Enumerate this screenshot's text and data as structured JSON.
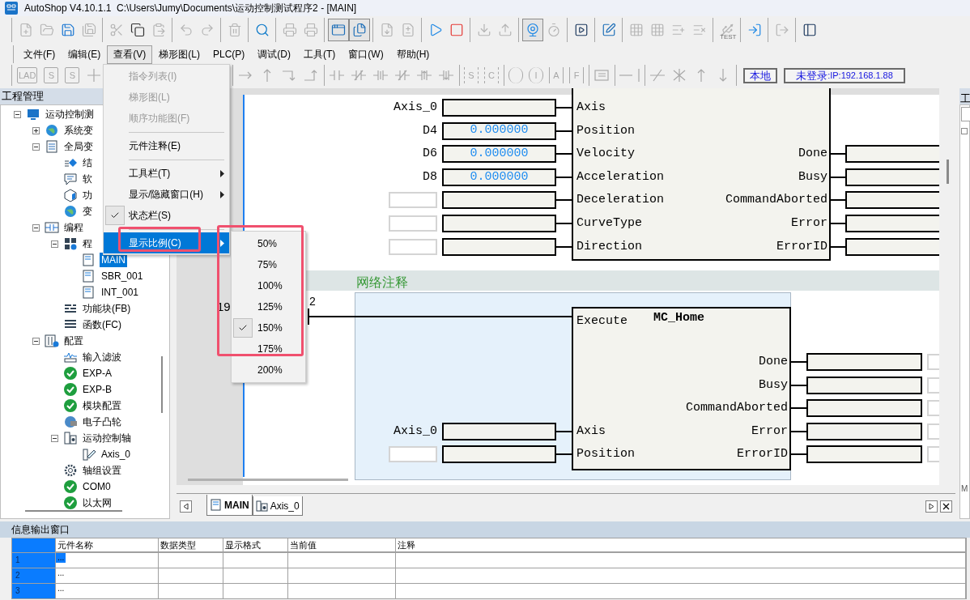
{
  "window": {
    "title": "AutoShop V4.10.1.1  C:\\Users\\Jumy\\Documents\\运动控制测试程序2 - [MAIN]"
  },
  "toolbar": {
    "groups": [
      [
        {
          "disabled": true,
          "pressed": false
        },
        {
          "disabled": true,
          "pressed": false
        },
        {
          "disabled": false,
          "pressed": false
        },
        {
          "disabled": true,
          "pressed": false
        }
      ],
      [
        {
          "disabled": true,
          "pressed": false
        },
        {
          "disabled": false,
          "pressed": false
        },
        {
          "disabled": true,
          "pressed": false
        }
      ],
      [
        {
          "disabled": true,
          "pressed": false
        },
        {
          "disabled": true,
          "pressed": false
        }
      ],
      [
        {
          "disabled": true,
          "pressed": false
        }
      ],
      [
        {
          "disabled": false,
          "pressed": false
        }
      ],
      [
        {
          "disabled": true,
          "pressed": false
        },
        {
          "disabled": true,
          "pressed": false
        }
      ],
      [
        {
          "disabled": false,
          "pressed": true
        },
        {
          "disabled": false,
          "pressed": true
        }
      ],
      [
        {
          "disabled": true,
          "pressed": false
        },
        {
          "disabled": true,
          "pressed": false
        }
      ],
      [
        {
          "disabled": false,
          "pressed": false
        },
        {
          "disabled": false,
          "pressed": false
        }
      ],
      [
        {
          "disabled": true,
          "pressed": false
        },
        {
          "disabled": true,
          "pressed": false
        }
      ],
      [
        {
          "disabled": false,
          "pressed": true
        },
        {
          "disabled": true,
          "pressed": false
        }
      ],
      [
        {
          "disabled": false,
          "pressed": false
        }
      ],
      [
        {
          "disabled": false,
          "pressed": false
        }
      ],
      [
        {
          "disabled": true,
          "pressed": false
        },
        {
          "disabled": true,
          "pressed": false
        },
        {
          "disabled": true,
          "pressed": false
        },
        {
          "disabled": true,
          "pressed": false
        }
      ],
      [
        {
          "disabled": true,
          "pressed": false,
          "glyph": "TEST"
        }
      ],
      [
        {
          "disabled": false,
          "pressed": false
        }
      ],
      [
        {
          "disabled": true,
          "pressed": false
        }
      ],
      [
        {
          "disabled": false,
          "pressed": false
        }
      ]
    ]
  },
  "menubar": [
    {
      "label": "文件(F)",
      "selected": false
    },
    {
      "label": "编辑(E)",
      "selected": false
    },
    {
      "label": "查看(V)",
      "selected": true
    },
    {
      "label": "梯形图(L)",
      "selected": false
    },
    {
      "label": "PLC(P)",
      "selected": false
    },
    {
      "label": "调试(D)",
      "selected": false
    },
    {
      "label": "工具(T)",
      "selected": false
    },
    {
      "label": "窗口(W)",
      "selected": false
    },
    {
      "label": "帮助(H)",
      "selected": false
    }
  ],
  "ladder_toolbar": {
    "left": [
      {
        "kind": "boxed",
        "glyph": "LAD",
        "disabled": true
      },
      {
        "kind": "boxed",
        "glyph": "S",
        "disabled": true
      },
      {
        "kind": "boxed",
        "glyph": "S",
        "disabled": true
      },
      {
        "kind": "cross",
        "disabled": true
      }
    ],
    "right": [
      [
        {
          "kind": "arrow-right",
          "disabled": true
        },
        {
          "kind": "arrow-up",
          "disabled": true
        },
        {
          "kind": "corner-down",
          "disabled": true
        },
        {
          "kind": "corner-up",
          "disabled": true
        }
      ],
      [
        {
          "kind": "contact",
          "disabled": true
        },
        {
          "kind": "contact-nc",
          "disabled": true
        },
        {
          "kind": "contact-p",
          "disabled": true
        },
        {
          "kind": "contact-nc",
          "disabled": true
        },
        {
          "kind": "contact-up",
          "disabled": true
        },
        {
          "kind": "contact-down",
          "disabled": true
        }
      ],
      [
        {
          "kind": "braced",
          "glyph": "S",
          "disabled": true
        },
        {
          "kind": "braced",
          "glyph": "C",
          "disabled": true
        }
      ],
      [
        {
          "kind": "paren",
          "disabled": true
        },
        {
          "kind": "paren",
          "glyph": "I",
          "disabled": true
        },
        {
          "kind": "bracketed",
          "glyph": "A",
          "disabled": true
        },
        {
          "kind": "bracketed",
          "glyph": "F",
          "disabled": true
        }
      ],
      [
        {
          "kind": "list",
          "disabled": true
        }
      ],
      [
        {
          "kind": "hline",
          "disabled": true
        },
        {
          "kind": "vline",
          "disabled": true
        }
      ],
      [
        {
          "kind": "slash",
          "disabled": true
        },
        {
          "kind": "star",
          "disabled": true
        },
        {
          "kind": "up",
          "disabled": true
        },
        {
          "kind": "down",
          "disabled": true
        }
      ]
    ],
    "mode": "本地",
    "connection_status": "未登录",
    "connection_ip": ":IP:192.168.1.88"
  },
  "project": {
    "title": "工程管理",
    "tree": [
      {
        "label": "运动控制测",
        "kind": "monitor",
        "expanded": true,
        "selected": false,
        "children": [
          {
            "label": "系统变",
            "kind": "globe",
            "expanded": false,
            "selected": false
          },
          {
            "label": "全局变",
            "kind": "doc",
            "expanded": true,
            "selected": false,
            "children": [
              {
                "label": "结",
                "kind": "struct",
                "selected": false
              },
              {
                "label": "软",
                "kind": "comment",
                "selected": false
              },
              {
                "label": "功",
                "kind": "cube",
                "selected": false
              },
              {
                "label": "变",
                "kind": "globe",
                "selected": false
              }
            ]
          },
          {
            "label": "编程",
            "kind": "rung",
            "expanded": true,
            "selected": false,
            "children": [
              {
                "label": "程",
                "kind": "grid",
                "expanded": true,
                "selected": false,
                "children": [
                  {
                    "label": "MAIN",
                    "kind": "program",
                    "selected": true
                  },
                  {
                    "label": "SBR_001",
                    "kind": "program",
                    "selected": false
                  },
                  {
                    "label": "INT_001",
                    "kind": "program",
                    "selected": false
                  }
                ]
              },
              {
                "label": "功能块(FB)",
                "kind": "fb",
                "selected": false
              },
              {
                "label": "函数(FC)",
                "kind": "fc",
                "selected": false
              }
            ]
          },
          {
            "label": "配置",
            "kind": "config",
            "expanded": true,
            "selected": false,
            "children": [
              {
                "label": "输入滤波",
                "kind": "filter",
                "selected": false
              },
              {
                "label": "EXP-A",
                "kind": "ok",
                "selected": false
              },
              {
                "label": "EXP-B",
                "kind": "ok",
                "selected": false
              },
              {
                "label": "模块配置",
                "kind": "ok",
                "selected": false
              },
              {
                "label": "电子凸轮",
                "kind": "cam",
                "selected": false
              },
              {
                "label": "运动控制轴",
                "kind": "axes",
                "expanded": true,
                "selected": false,
                "children": [
                  {
                    "label": "Axis_0",
                    "kind": "axis",
                    "selected": false
                  }
                ]
              },
              {
                "label": "轴组设置",
                "kind": "gear",
                "selected": false
              },
              {
                "label": "COM0",
                "kind": "ok",
                "selected": false
              },
              {
                "label": "以太网",
                "kind": "ok",
                "selected": false
              }
            ]
          }
        ]
      }
    ]
  },
  "editor": {
    "block_1": {
      "inputs": [
        {
          "operand": "Axis_0",
          "pin": "Axis"
        },
        {
          "operand": "D4",
          "value": "0.000000",
          "pin": "Position"
        },
        {
          "operand": "D6",
          "value": "0.000000",
          "pin": "Velocity"
        },
        {
          "operand": "D8",
          "value": "0.000000",
          "pin": "Acceleration"
        },
        {
          "pin": "Deceleration"
        },
        {
          "pin": "CurveType"
        },
        {
          "pin": "Direction"
        }
      ],
      "outputs": [
        {
          "pin": "Done"
        },
        {
          "pin": "Busy"
        },
        {
          "pin": "CommandAborted"
        },
        {
          "pin": "Error"
        },
        {
          "pin": "ErrorID"
        }
      ]
    },
    "network_comment": "网络注释",
    "network_number": "19",
    "network_number_tail": "2",
    "block_2": {
      "title": "MC_Home",
      "enable_pin": "Execute",
      "inputs": [
        {
          "operand": "Axis_0",
          "pin": "Axis"
        },
        {
          "pin": "Position"
        }
      ],
      "outputs": [
        {
          "pin": "Done"
        },
        {
          "pin": "Busy"
        },
        {
          "pin": "CommandAborted"
        },
        {
          "pin": "Error"
        },
        {
          "pin": "ErrorID"
        }
      ]
    }
  },
  "tabs": [
    {
      "label": "MAIN",
      "selected": true
    },
    {
      "label": "Axis_0",
      "selected": false
    }
  ],
  "right_panel": {
    "title": "工",
    "item": "M"
  },
  "output": {
    "title": "信息输出窗口",
    "columns": [
      "元件名称",
      "数据类型",
      "显示格式",
      "当前值",
      "注释"
    ],
    "rows": [
      {
        "number": "1",
        "name": "...",
        "selected": true
      },
      {
        "number": "2",
        "name": "...",
        "selected": false
      },
      {
        "number": "3",
        "name": "...",
        "selected": false
      }
    ]
  },
  "view_menu": {
    "items": [
      {
        "kind": "item",
        "label": "指令列表(I)",
        "disabled": true,
        "checked": false,
        "submenu": false,
        "selected": false
      },
      {
        "kind": "item",
        "label": "梯形图(L)",
        "disabled": true,
        "checked": false,
        "submenu": false,
        "selected": false
      },
      {
        "kind": "item",
        "label": "顺序功能图(F)",
        "disabled": true,
        "checked": false,
        "submenu": false,
        "selected": false
      },
      {
        "kind": "separator"
      },
      {
        "kind": "item",
        "label": "元件注释(E)",
        "disabled": false,
        "checked": false,
        "submenu": false,
        "selected": false
      },
      {
        "kind": "separator"
      },
      {
        "kind": "item",
        "label": "工具栏(T)",
        "disabled": false,
        "checked": false,
        "submenu": true,
        "selected": false
      },
      {
        "kind": "item",
        "label": "显示/隐藏窗口(H)",
        "disabled": false,
        "checked": false,
        "submenu": true,
        "selected": false
      },
      {
        "kind": "item",
        "label": "状态栏(S)",
        "disabled": false,
        "checked": true,
        "submenu": false,
        "selected": false
      },
      {
        "kind": "separator"
      },
      {
        "kind": "item",
        "label": "显示比例(C)",
        "disabled": false,
        "checked": false,
        "submenu": true,
        "selected": true
      }
    ]
  },
  "zoom_menu": {
    "items": [
      {
        "label": "50%",
        "checked": false
      },
      {
        "label": "75%",
        "checked": false
      },
      {
        "label": "100%",
        "checked": false
      },
      {
        "label": "125%",
        "checked": false
      },
      {
        "label": "150%",
        "checked": true
      },
      {
        "label": "175%",
        "checked": false
      },
      {
        "label": "200%",
        "checked": false
      }
    ]
  }
}
